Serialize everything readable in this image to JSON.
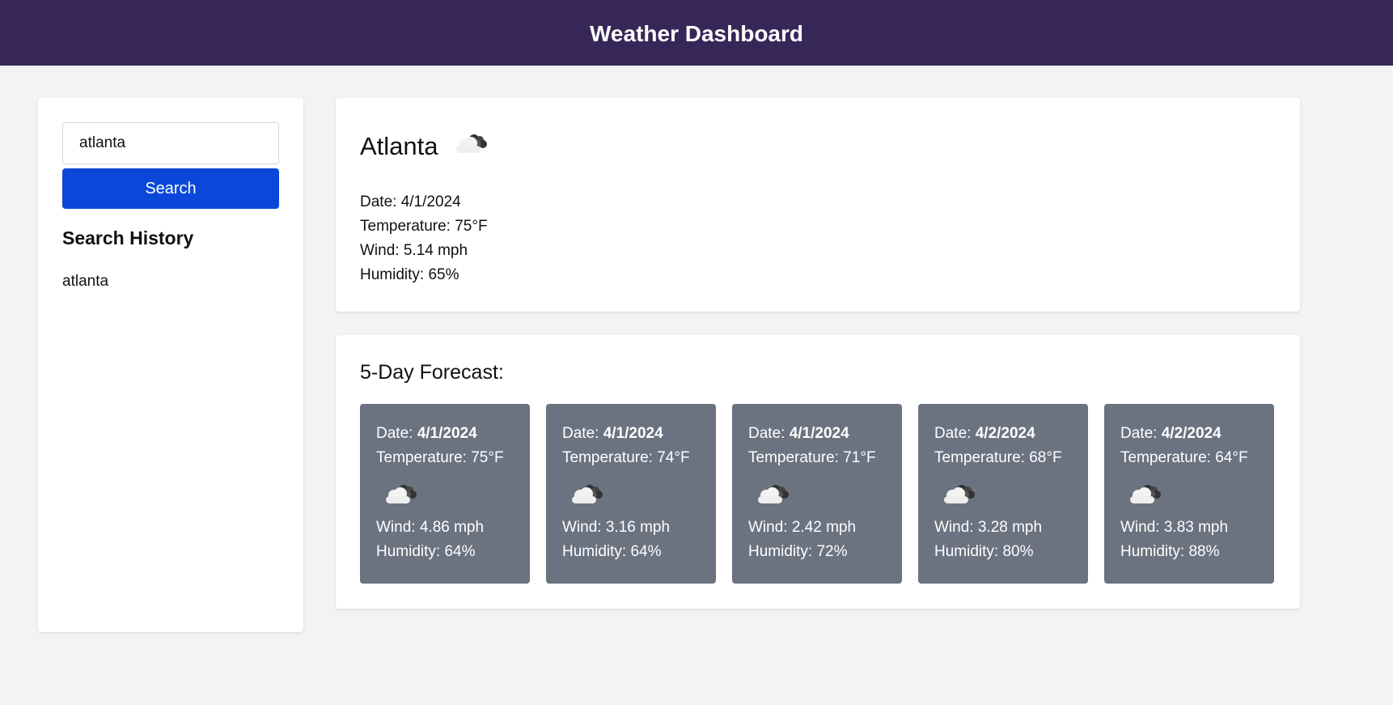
{
  "header": {
    "title": "Weather Dashboard"
  },
  "search": {
    "value": "atlanta",
    "button_label": "Search"
  },
  "history": {
    "title": "Search History",
    "items": [
      "atlanta"
    ]
  },
  "current": {
    "city": "Atlanta",
    "icon": "cloud-icon",
    "date": "Date: 4/1/2024",
    "temperature": "Temperature: 75°F",
    "wind": "Wind: 5.14 mph",
    "humidity": "Humidity: 65%"
  },
  "forecast": {
    "title": "5-Day Forecast:",
    "date_prefix": "Date: ",
    "days": [
      {
        "date": "4/1/2024",
        "temperature": "Temperature: 75°F",
        "wind": "Wind: 4.86 mph",
        "humidity": "Humidity: 64%"
      },
      {
        "date": "4/1/2024",
        "temperature": "Temperature: 74°F",
        "wind": "Wind: 3.16 mph",
        "humidity": "Humidity: 64%"
      },
      {
        "date": "4/1/2024",
        "temperature": "Temperature: 71°F",
        "wind": "Wind: 2.42 mph",
        "humidity": "Humidity: 72%"
      },
      {
        "date": "4/2/2024",
        "temperature": "Temperature: 68°F",
        "wind": "Wind: 3.28 mph",
        "humidity": "Humidity: 80%"
      },
      {
        "date": "4/2/2024",
        "temperature": "Temperature: 64°F",
        "wind": "Wind: 3.83 mph",
        "humidity": "Humidity: 88%"
      }
    ]
  },
  "colors": {
    "header": "#362758",
    "button": "#0b48d9",
    "card": "#6b7280",
    "background": "#f2f3f5"
  }
}
